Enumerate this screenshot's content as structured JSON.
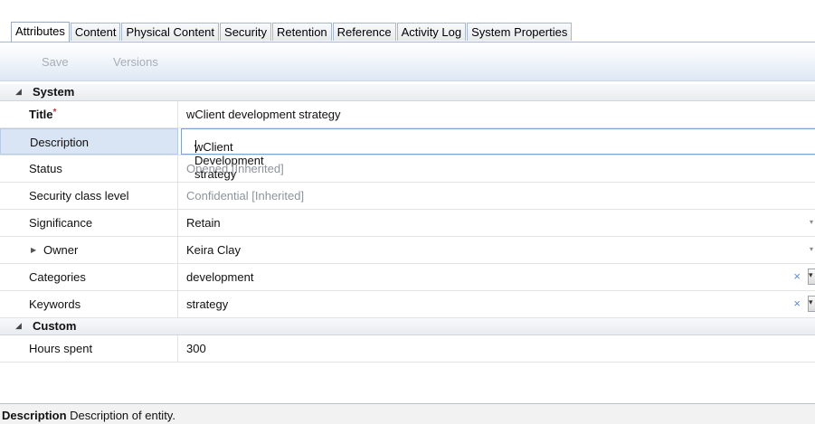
{
  "tabs": [
    "Attributes",
    "Content",
    "Physical Content",
    "Security",
    "Retention",
    "Reference",
    "Activity Log",
    "System Properties"
  ],
  "toolbar": {
    "save_label": "Save",
    "versions_label": "Versions"
  },
  "groups": {
    "system": "System",
    "custom": "Custom"
  },
  "fields": {
    "title": {
      "label": "Title",
      "required_mark": "*",
      "value": "wClient development strategy"
    },
    "description": {
      "label": "Description",
      "value": "wClient Development strategy"
    },
    "status": {
      "label": "Status",
      "value": "Opened [Inherited]"
    },
    "security_class_level": {
      "label": "Security class level",
      "value": "Confidential [Inherited]"
    },
    "significance": {
      "label": "Significance",
      "value": "Retain"
    },
    "owner": {
      "label": "Owner",
      "value": "Keira Clay"
    },
    "categories": {
      "label": "Categories",
      "value": "development"
    },
    "keywords": {
      "label": "Keywords",
      "value": "strategy"
    },
    "hours_spent": {
      "label": "Hours spent",
      "value": "300"
    }
  },
  "statusbar": {
    "field": "Description",
    "text": "Description of entity."
  },
  "icons": {
    "clear": "×",
    "expand": "▶",
    "collapse": "◢",
    "dropdown": "▾"
  }
}
